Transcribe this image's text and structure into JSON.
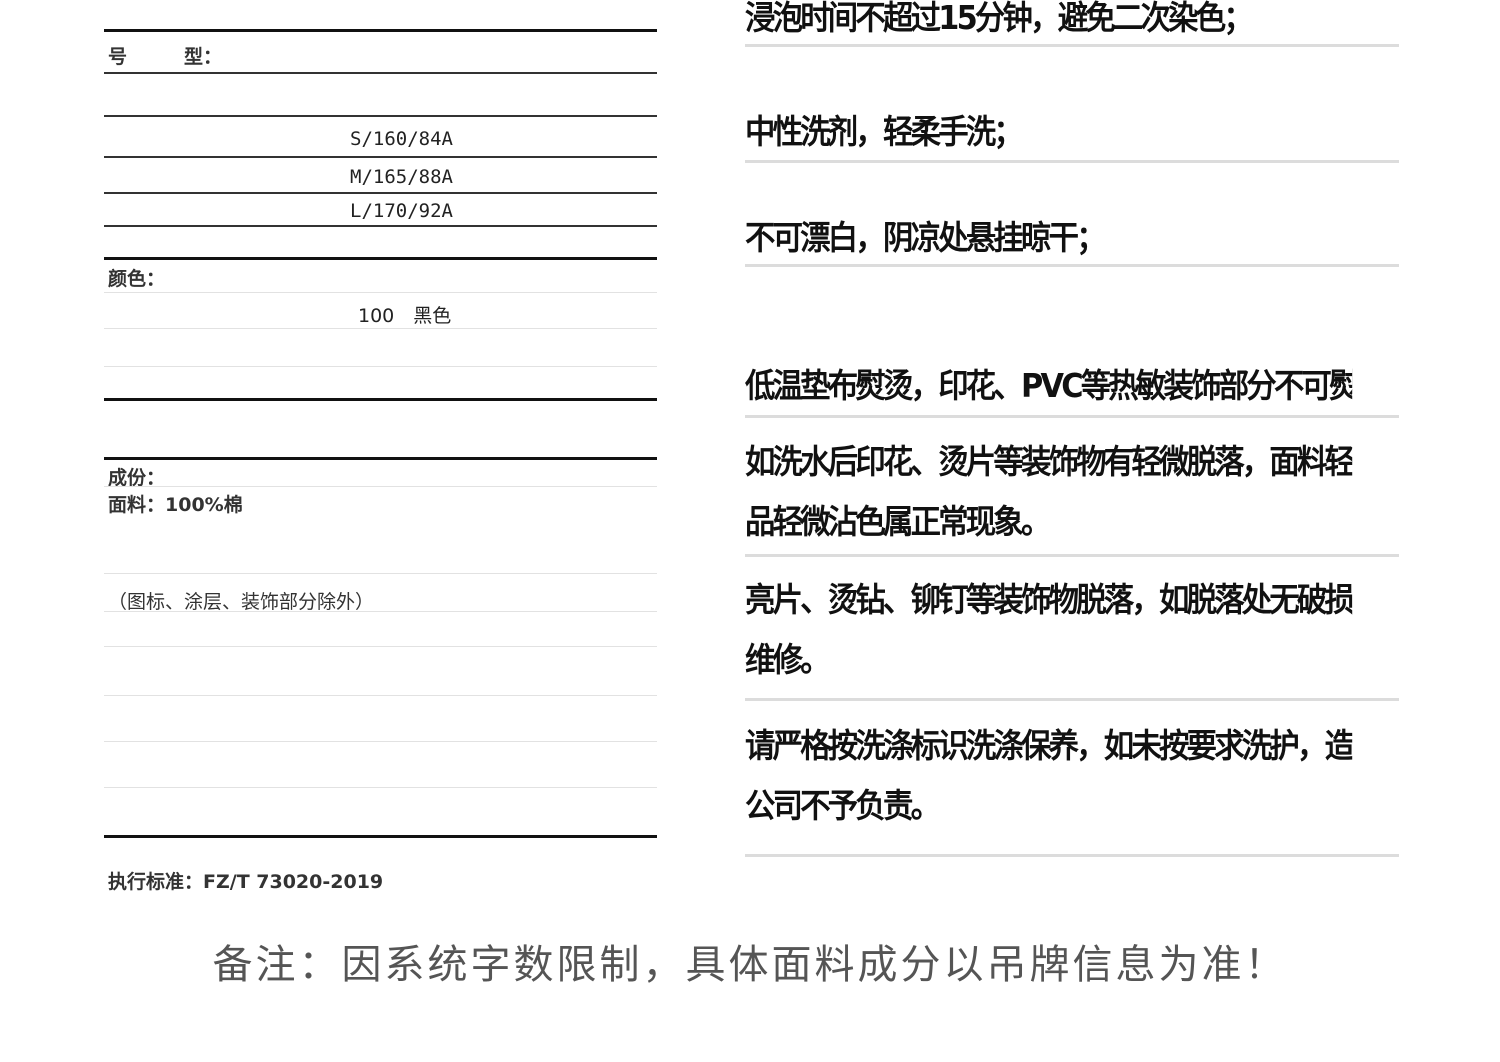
{
  "left_label": {
    "model_label": "号　　　型：",
    "sizes": [
      "S/160/84A",
      "M/165/88A",
      "L/170/92A"
    ],
    "color_label": "颜色：",
    "color_value": "100　黑色",
    "composition_label": "成份：",
    "fabric_line": "面料：100%棉",
    "exclusion_note": "（图标、涂层、装饰部分除外）",
    "standard": "执行标准：FZ/T 73020-2019"
  },
  "care_instructions": [
    [
      "浸泡时间不超过15分钟，避免二次染色；"
    ],
    [
      "中性洗剂，轻柔手洗；"
    ],
    [
      "不可漂白，阴凉处悬挂晾干；"
    ],
    [
      "低温垫布熨烫，印花、PVC等热敏装饰部分不可熨烫；"
    ],
    [
      "如洗水后印花、烫片等装饰物有轻微脱落，面料轻微掉色，撞色产",
      "品轻微沾色属正常现象。"
    ],
    [
      "亮片、烫钻、铆钉等装饰物脱落，如脱落处无破损，可返公司免费",
      "维修。"
    ],
    [
      "请严格按洗涤标识洗涤保养，如未按要求洗护，造成的任何损失，",
      "公司不予负责。"
    ]
  ],
  "footer_note": "备注：因系统字数限制，具体面料成分以吊牌信息为准！"
}
